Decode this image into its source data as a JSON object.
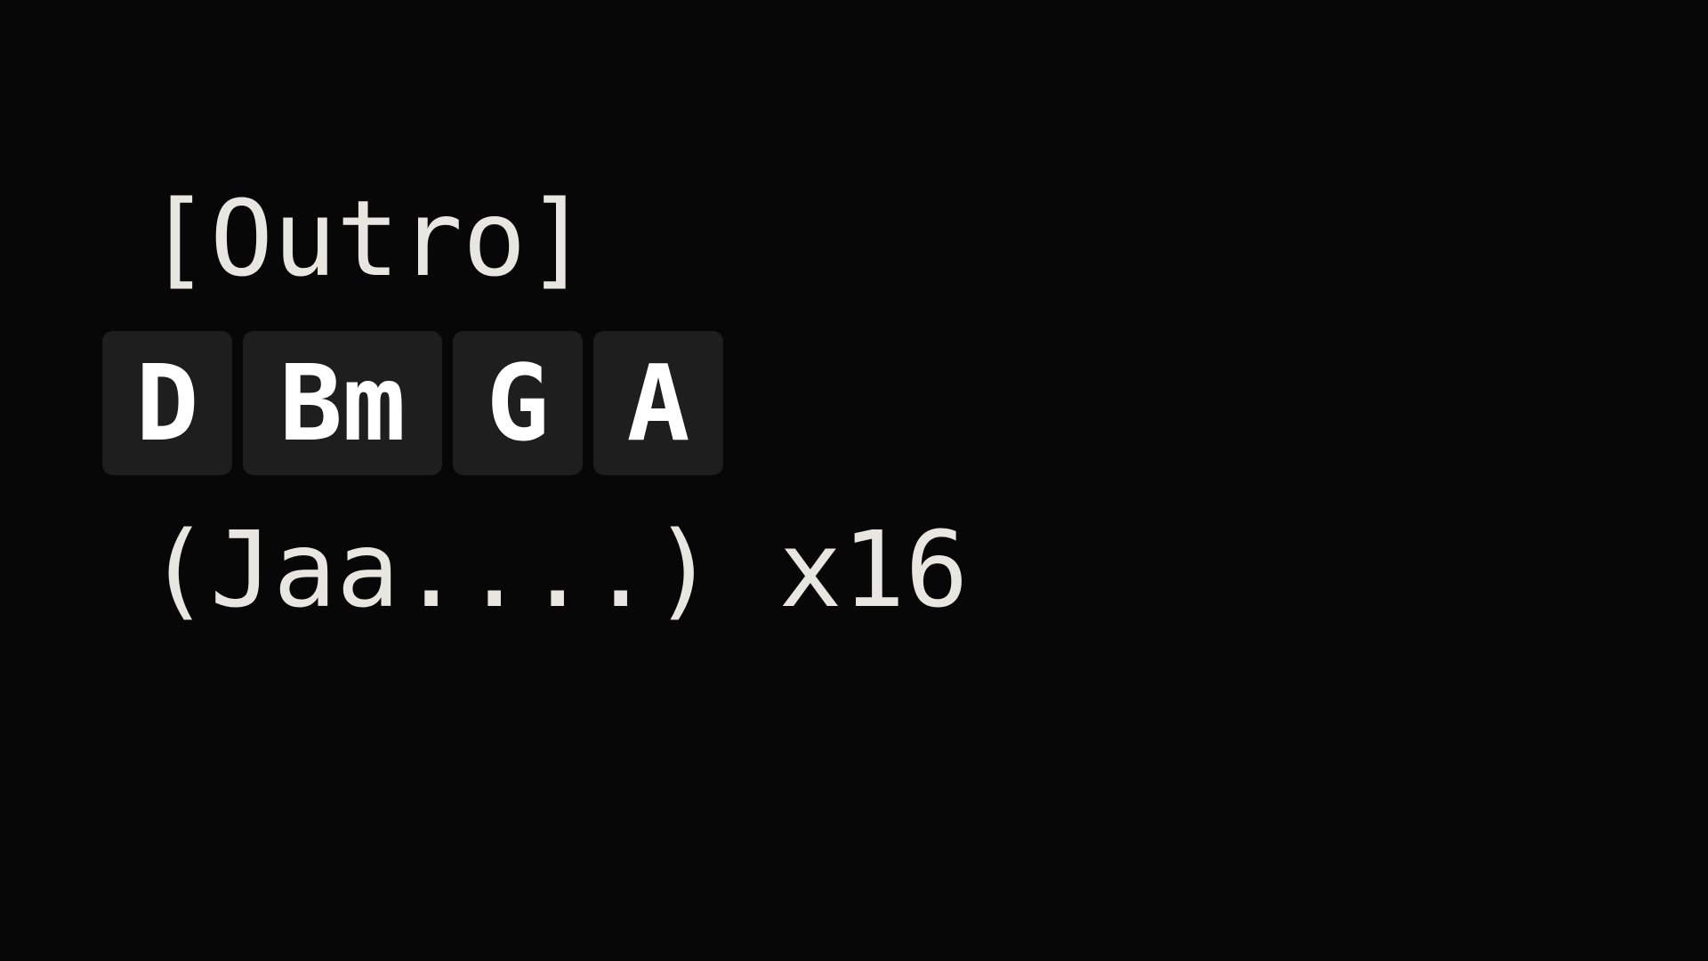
{
  "song": {
    "section": "[Outro]",
    "chords": [
      "D",
      "Bm",
      "G",
      "A"
    ],
    "lyric": "(Jaa....) x16"
  },
  "colors": {
    "background": "#070707",
    "text": "#e8e6e1",
    "chord_bg": "#1e1e1e",
    "chord_text": "#ffffff"
  }
}
